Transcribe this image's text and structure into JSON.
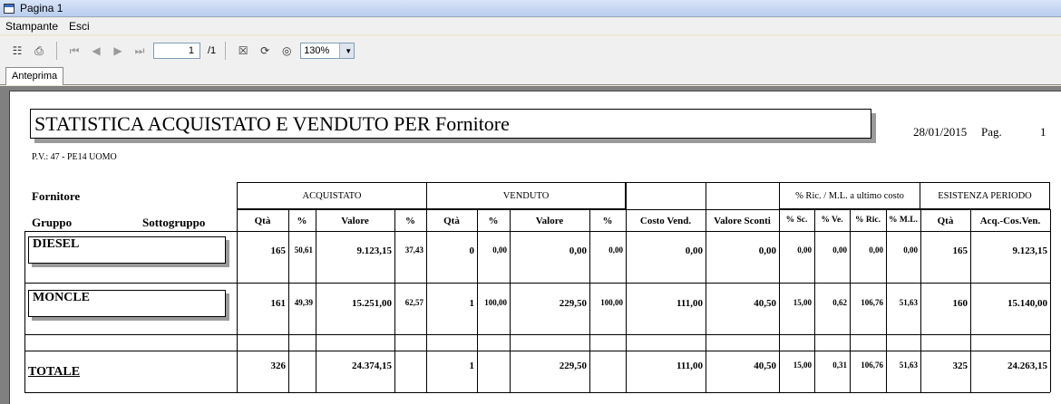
{
  "window": {
    "title": "Pagina 1"
  },
  "menu": {
    "items": [
      "Stampante",
      "Esci"
    ]
  },
  "toolbar": {
    "page_current": "1",
    "page_total": "/1",
    "zoom": "130%"
  },
  "tabs": [
    "Anteprima"
  ],
  "report": {
    "title": "STATISTICA ACQUISTATO E VENDUTO PER Fornitore",
    "date": "28/01/2015",
    "pag_label": "Pag.",
    "pag_number": "1",
    "pv": "P.V.: 47 - PE14 UOMO",
    "labels": {
      "fornitore": "Fornitore",
      "gruppo": "Gruppo",
      "sottogruppo": "Sottogruppo"
    },
    "groups": {
      "acquistato": "ACQUISTATO",
      "venduto": "VENDUTO",
      "ricarico": "% Ric. / M.L. a ultimo costo",
      "esistenza": "ESISTENZA PERIODO"
    },
    "columns": [
      "Qtà",
      "%",
      "Valore",
      "%",
      "Qtà",
      "%",
      "Valore",
      "%",
      "Costo Vend.",
      "Valore Sconti",
      "% Sc.",
      "% Ve.",
      "% Ric.",
      "% M.L.",
      "Qtà",
      "Acq.-Cos.Ven."
    ],
    "rows": [
      {
        "name": "DIESEL",
        "values": [
          "165",
          "50,61",
          "9.123,15",
          "37,43",
          "0",
          "0,00",
          "0,00",
          "0,00",
          "0,00",
          "0,00",
          "0,00",
          "0,00",
          "0,00",
          "0,00",
          "165",
          "9.123,15"
        ]
      },
      {
        "name": "MONCLE",
        "values": [
          "161",
          "49,39",
          "15.251,00",
          "62,57",
          "1",
          "100,00",
          "229,50",
          "100,00",
          "111,00",
          "40,50",
          "15,00",
          "0,62",
          "106,76",
          "51,63",
          "160",
          "15.140,00"
        ]
      }
    ],
    "total": {
      "label": "TOTALE",
      "values": [
        "326",
        "",
        "24.374,15",
        "",
        "1",
        "",
        "229,50",
        "",
        "111,00",
        "40,50",
        "15,00",
        "0,31",
        "106,76",
        "51,63",
        "325",
        "24.263,15"
      ]
    }
  }
}
